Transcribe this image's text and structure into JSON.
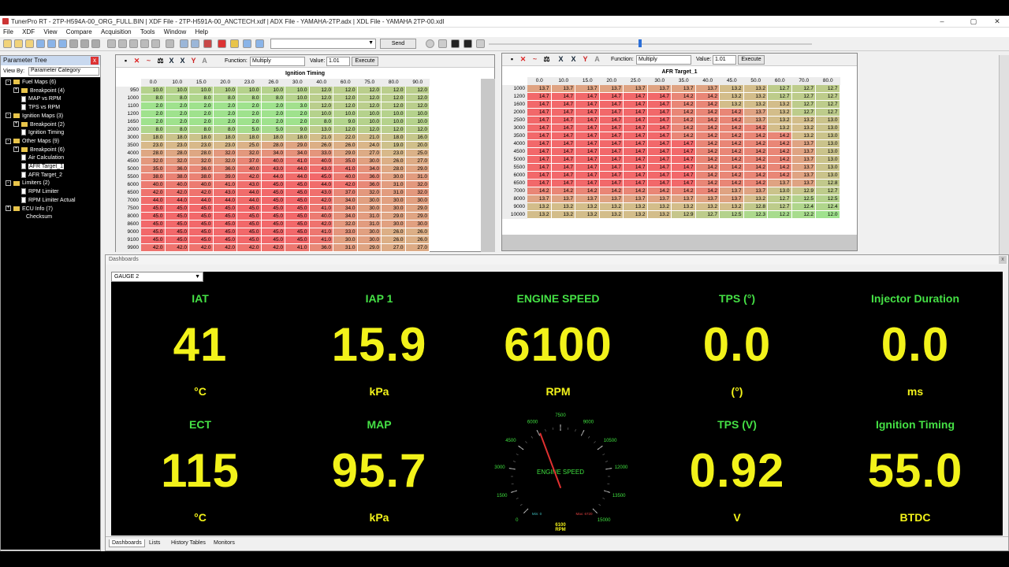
{
  "window": {
    "title": "TunerPro RT - 2TP-H594A-00_ORG_FULL.BIN | XDF File - 2TP-H591A-00_ANCTECH.xdf | ADX File - YAMAHA-2TP.adx | XDL File - YAMAHA 2TP-00.xdl",
    "minimize": "–",
    "maximize": "▢",
    "close": "✕"
  },
  "menu": [
    "File",
    "XDF",
    "View",
    "Compare",
    "Acquisition",
    "Tools",
    "Window",
    "Help"
  ],
  "toolbar": {
    "send_label": "Send"
  },
  "parameter_tree": {
    "title": "Parameter Tree",
    "close": "x",
    "view_by_label": "View By:",
    "view_by_value": "Parameter Category",
    "items": [
      {
        "label": "Fuel Maps (6)",
        "level": 0,
        "kind": "folder",
        "expand": "-"
      },
      {
        "label": "Breakpoint (4)",
        "level": 1,
        "kind": "folder",
        "expand": "+"
      },
      {
        "label": "MAP vs RPM",
        "level": 1,
        "kind": "doc"
      },
      {
        "label": "TPS vs RPM",
        "level": 1,
        "kind": "doc"
      },
      {
        "label": "Ignition Maps (3)",
        "level": 0,
        "kind": "folder",
        "expand": "-"
      },
      {
        "label": "Breakpoint (2)",
        "level": 1,
        "kind": "folder",
        "expand": "+"
      },
      {
        "label": "Ignition Timing",
        "level": 1,
        "kind": "doc"
      },
      {
        "label": "Other Maps (9)",
        "level": 0,
        "kind": "folder",
        "expand": "-"
      },
      {
        "label": "Breakpoint (6)",
        "level": 1,
        "kind": "folder",
        "expand": "+"
      },
      {
        "label": "Air Calculation",
        "level": 1,
        "kind": "doc"
      },
      {
        "label": "AFR Target_1",
        "level": 1,
        "kind": "doc",
        "selected": true
      },
      {
        "label": "AFR Target_2",
        "level": 1,
        "kind": "doc"
      },
      {
        "label": "Limiters (2)",
        "level": 0,
        "kind": "folder",
        "expand": "-"
      },
      {
        "label": "RPM Limiter",
        "level": 1,
        "kind": "doc"
      },
      {
        "label": "RPM Limiter Actual",
        "level": 1,
        "kind": "doc"
      },
      {
        "label": "ECU Info (7)",
        "level": 0,
        "kind": "folder",
        "expand": "+"
      },
      {
        "label": "Checksum",
        "level": 1,
        "kind": "none"
      }
    ]
  },
  "ignition_table": {
    "function_label": "Function:",
    "function_value": "Multiply",
    "value_label": "Value:",
    "value": "1.01",
    "execute": "Execute",
    "title": "Ignition Timing",
    "x_axis": [
      "0.0",
      "10.0",
      "15.0",
      "20.0",
      "23.0",
      "26.0",
      "30.0",
      "40.0",
      "60.0",
      "75.0",
      "80.0",
      "90.0"
    ],
    "y_axis": [
      "950",
      "1000",
      "1100",
      "1200",
      "1650",
      "2000",
      "3000",
      "3500",
      "4000",
      "4500",
      "5000",
      "5500",
      "6000",
      "6500",
      "7000",
      "7500",
      "8000",
      "8600",
      "9000",
      "9100",
      "9900"
    ],
    "rows": [
      [
        "10.0",
        "10.0",
        "10.0",
        "10.0",
        "10.0",
        "10.0",
        "10.0",
        "12.0",
        "12.0",
        "12.0",
        "12.0",
        "12.0"
      ],
      [
        "8.0",
        "8.0",
        "8.0",
        "8.0",
        "8.0",
        "8.0",
        "10.0",
        "12.0",
        "12.0",
        "12.0",
        "12.0",
        "12.0"
      ],
      [
        "2.0",
        "2.0",
        "2.0",
        "2.0",
        "2.0",
        "2.0",
        "3.0",
        "12.0",
        "12.0",
        "12.0",
        "12.0",
        "12.0"
      ],
      [
        "2.0",
        "2.0",
        "2.0",
        "2.0",
        "2.0",
        "2.0",
        "2.0",
        "10.0",
        "10.0",
        "10.0",
        "10.0",
        "10.0"
      ],
      [
        "2.0",
        "2.0",
        "2.0",
        "2.0",
        "2.0",
        "2.0",
        "2.0",
        "8.0",
        "9.0",
        "10.0",
        "10.0",
        "10.0"
      ],
      [
        "8.0",
        "8.0",
        "8.0",
        "8.0",
        "5.0",
        "5.0",
        "9.0",
        "13.0",
        "12.0",
        "12.0",
        "12.0",
        "12.0"
      ],
      [
        "18.0",
        "18.0",
        "18.0",
        "18.0",
        "18.0",
        "18.0",
        "18.0",
        "21.0",
        "22.0",
        "21.0",
        "18.0",
        "16.0"
      ],
      [
        "23.0",
        "23.0",
        "23.0",
        "23.0",
        "25.0",
        "28.0",
        "29.0",
        "26.0",
        "26.0",
        "24.0",
        "19.0",
        "20.0"
      ],
      [
        "28.0",
        "28.0",
        "28.0",
        "32.0",
        "32.0",
        "34.0",
        "34.0",
        "33.0",
        "29.0",
        "27.0",
        "23.0",
        "25.0"
      ],
      [
        "32.0",
        "32.0",
        "32.0",
        "32.0",
        "37.0",
        "40.0",
        "41.0",
        "40.0",
        "35.0",
        "30.0",
        "26.0",
        "27.0"
      ],
      [
        "35.0",
        "36.0",
        "36.0",
        "36.0",
        "40.0",
        "43.0",
        "44.0",
        "43.0",
        "41.0",
        "34.0",
        "28.0",
        "29.0"
      ],
      [
        "38.0",
        "38.0",
        "38.0",
        "39.0",
        "42.0",
        "44.0",
        "44.0",
        "45.0",
        "40.0",
        "36.0",
        "30.0",
        "31.0"
      ],
      [
        "40.0",
        "40.0",
        "40.0",
        "41.0",
        "43.0",
        "45.0",
        "45.0",
        "44.0",
        "42.0",
        "36.0",
        "31.0",
        "32.0"
      ],
      [
        "42.0",
        "42.0",
        "42.0",
        "43.0",
        "44.0",
        "45.0",
        "45.0",
        "43.0",
        "37.0",
        "32.0",
        "31.0",
        "32.0"
      ],
      [
        "44.0",
        "44.0",
        "44.0",
        "44.0",
        "44.0",
        "45.0",
        "45.0",
        "42.0",
        "34.0",
        "30.0",
        "30.0",
        "30.0"
      ],
      [
        "45.0",
        "45.0",
        "45.0",
        "45.0",
        "45.0",
        "45.0",
        "45.0",
        "41.0",
        "34.0",
        "30.0",
        "30.0",
        "29.0"
      ],
      [
        "45.0",
        "45.0",
        "45.0",
        "45.0",
        "45.0",
        "45.0",
        "45.0",
        "40.0",
        "34.0",
        "31.0",
        "29.0",
        "29.0"
      ],
      [
        "45.0",
        "45.0",
        "45.0",
        "45.0",
        "45.0",
        "45.0",
        "45.0",
        "42.0",
        "32.0",
        "31.0",
        "30.0",
        "30.0"
      ],
      [
        "45.0",
        "45.0",
        "45.0",
        "45.0",
        "45.0",
        "45.0",
        "45.0",
        "41.0",
        "33.0",
        "30.0",
        "26.0",
        "26.0"
      ],
      [
        "45.0",
        "45.0",
        "45.0",
        "45.0",
        "45.0",
        "45.0",
        "45.0",
        "41.0",
        "30.0",
        "30.0",
        "26.0",
        "26.0"
      ],
      [
        "42.0",
        "42.0",
        "42.0",
        "42.0",
        "42.0",
        "42.0",
        "41.0",
        "36.0",
        "31.0",
        "29.0",
        "27.0",
        "27.0"
      ]
    ]
  },
  "afr_table": {
    "function_label": "Function:",
    "function_value": "Multiply",
    "value_label": "Value:",
    "value": "1.01",
    "execute": "Execute",
    "title": "AFR Target_1",
    "x_axis": [
      "0.0",
      "10.0",
      "15.0",
      "20.0",
      "25.0",
      "30.0",
      "35.0",
      "40.0",
      "45.0",
      "50.0",
      "60.0",
      "70.0",
      "80.0"
    ],
    "y_axis": [
      "1000",
      "1200",
      "1600",
      "2000",
      "2500",
      "3000",
      "3500",
      "4000",
      "4500",
      "5000",
      "5500",
      "6000",
      "6500",
      "7000",
      "8000",
      "9000",
      "10000"
    ],
    "rows": [
      [
        "13.7",
        "13.7",
        "13.7",
        "13.7",
        "13.7",
        "13.7",
        "13.7",
        "13.7",
        "13.2",
        "13.2",
        "12.7",
        "12.7",
        "12.7"
      ],
      [
        "14.7",
        "14.7",
        "14.7",
        "14.7",
        "14.7",
        "14.7",
        "14.2",
        "14.2",
        "13.2",
        "13.2",
        "12.7",
        "12.7",
        "12.7"
      ],
      [
        "14.7",
        "14.7",
        "14.7",
        "14.7",
        "14.7",
        "14.7",
        "14.2",
        "14.2",
        "13.2",
        "13.2",
        "13.2",
        "12.7",
        "12.7"
      ],
      [
        "14.7",
        "14.7",
        "14.7",
        "14.7",
        "14.7",
        "14.7",
        "14.2",
        "14.2",
        "14.2",
        "13.7",
        "13.2",
        "12.7",
        "12.7"
      ],
      [
        "14.7",
        "14.7",
        "14.7",
        "14.7",
        "14.7",
        "14.7",
        "14.2",
        "14.2",
        "14.2",
        "13.7",
        "13.2",
        "13.2",
        "13.0"
      ],
      [
        "14.7",
        "14.7",
        "14.7",
        "14.7",
        "14.7",
        "14.7",
        "14.2",
        "14.2",
        "14.2",
        "14.2",
        "13.2",
        "13.2",
        "13.0"
      ],
      [
        "14.7",
        "14.7",
        "14.7",
        "14.7",
        "14.7",
        "14.7",
        "14.2",
        "14.2",
        "14.2",
        "14.2",
        "14.2",
        "13.2",
        "13.0"
      ],
      [
        "14.7",
        "14.7",
        "14.7",
        "14.7",
        "14.7",
        "14.7",
        "14.7",
        "14.2",
        "14.2",
        "14.2",
        "14.2",
        "13.7",
        "13.0"
      ],
      [
        "14.7",
        "14.7",
        "14.7",
        "14.7",
        "14.7",
        "14.7",
        "14.7",
        "14.2",
        "14.2",
        "14.2",
        "14.2",
        "13.7",
        "13.0"
      ],
      [
        "14.7",
        "14.7",
        "14.7",
        "14.7",
        "14.7",
        "14.7",
        "14.7",
        "14.2",
        "14.2",
        "14.2",
        "14.2",
        "13.7",
        "13.0"
      ],
      [
        "14.7",
        "14.7",
        "14.7",
        "14.7",
        "14.7",
        "14.7",
        "14.7",
        "14.2",
        "14.2",
        "14.2",
        "14.2",
        "13.7",
        "13.0"
      ],
      [
        "14.7",
        "14.7",
        "14.7",
        "14.7",
        "14.7",
        "14.7",
        "14.7",
        "14.2",
        "14.2",
        "14.2",
        "14.2",
        "13.7",
        "13.0"
      ],
      [
        "14.7",
        "14.7",
        "14.7",
        "14.7",
        "14.7",
        "14.7",
        "14.7",
        "14.2",
        "14.2",
        "14.2",
        "13.7",
        "13.7",
        "12.8"
      ],
      [
        "14.2",
        "14.2",
        "14.2",
        "14.2",
        "14.2",
        "14.2",
        "14.2",
        "14.2",
        "13.7",
        "13.7",
        "13.0",
        "12.9",
        "12.7"
      ],
      [
        "13.7",
        "13.7",
        "13.7",
        "13.7",
        "13.7",
        "13.7",
        "13.7",
        "13.7",
        "13.7",
        "13.2",
        "12.7",
        "12.5",
        "12.5"
      ],
      [
        "13.2",
        "13.2",
        "13.2",
        "13.2",
        "13.2",
        "13.2",
        "13.2",
        "13.2",
        "13.2",
        "12.8",
        "12.7",
        "12.4",
        "12.4"
      ],
      [
        "13.2",
        "13.2",
        "13.2",
        "13.2",
        "13.2",
        "13.2",
        "12.9",
        "12.7",
        "12.5",
        "12.3",
        "12.2",
        "12.2",
        "12.0"
      ]
    ]
  },
  "dashboard": {
    "title": "Dashboards",
    "close": "x",
    "gauge_select": "GAUGE 2",
    "gauges": [
      {
        "name": "IAT",
        "value": "41",
        "unit": "°C"
      },
      {
        "name": "IAP 1",
        "value": "15.9",
        "unit": "kPa"
      },
      {
        "name": "ENGINE SPEED",
        "value": "6100",
        "unit": "RPM"
      },
      {
        "name": "TPS (°)",
        "value": "0.0",
        "unit": "(°)"
      },
      {
        "name": "Injector Duration",
        "value": "0.0",
        "unit": "ms"
      },
      {
        "name": "ECT",
        "value": "115",
        "unit": "°C"
      },
      {
        "name": "MAP",
        "value": "95.7",
        "unit": "kPa"
      },
      {
        "name": "TPS (V)",
        "value": "0.92",
        "unit": "V"
      },
      {
        "name": "Ignition Timing",
        "value": "55.0",
        "unit": "BTDC"
      }
    ],
    "dial": {
      "label": "ENGINE SPEED",
      "value": 6100,
      "unit": "RPM",
      "min": 0,
      "max": 15000,
      "ticks": [
        "0",
        "1500",
        "3000",
        "4500",
        "6000",
        "7500",
        "9000",
        "10500",
        "12000",
        "13500",
        "15000"
      ],
      "min_label": "Min: 0",
      "max_label": "Max: 6720",
      "value_label": "6100",
      "needle_color": "#e03030",
      "tick_color": "#3fe03f"
    },
    "tabs": [
      "Dashboards",
      "Lists",
      "History Tables",
      "Monitors"
    ]
  },
  "colors": {
    "gauge_name": "#45e045",
    "gauge_value": "#f2f21a",
    "cell_low": "#9fe28d",
    "cell_mid": "#d9b88a",
    "cell_high": "#f2686a"
  }
}
